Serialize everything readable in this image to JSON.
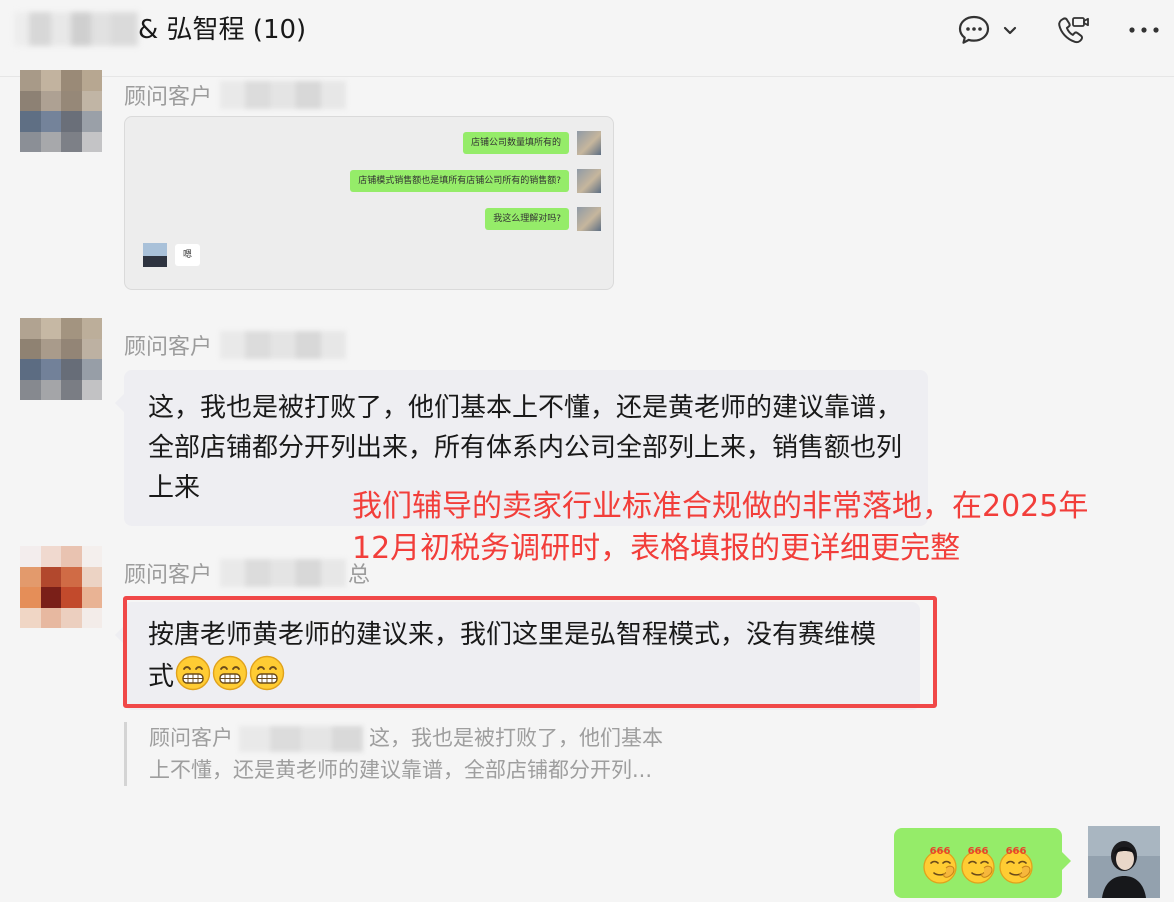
{
  "header": {
    "title": "& 弘智程 (10)",
    "icons": [
      "chat-bubble-icon",
      "chevron-down-icon",
      "video-call-icon",
      "more-icon"
    ]
  },
  "messages": [
    {
      "sender": "顾问客户",
      "sender_suffix": "",
      "type": "image",
      "screenshot": {
        "outgoing": [
          "店铺公司数量填所有的",
          "店铺模式销售额也是填所有店铺公司所有的销售额?",
          "我这么理解对吗?"
        ],
        "incoming": [
          "嗯"
        ]
      }
    },
    {
      "sender": "顾问客户",
      "sender_suffix": "",
      "type": "text",
      "text": "这，我也是被打败了，他们基本上不懂，还是黄老师的建议靠谱，全部店铺都分开列出来，所有体系内公司全部列上来，销售额也列上来"
    },
    {
      "sender": "顾问客户",
      "sender_suffix": "总",
      "type": "text",
      "text": "按唐老师黄老师的建议来，我们这里是弘智程模式，没有赛维模式",
      "emojis": [
        "grin-emoji",
        "grin-emoji",
        "grin-emoji"
      ],
      "highlighted": true
    }
  ],
  "quote": {
    "sender": "顾问客户",
    "line1": "这，我也是被打败了，他们基本",
    "line2": "上不懂，还是黄老师的建议靠谱，全部店铺都分开列..."
  },
  "annotation": {
    "line1": "我们辅导的卖家行业标准合规做的非常落地，在2025年",
    "line2": "12月初税务调研时，表格填报的更详细更完整",
    "color": "#f23e3a"
  },
  "outgoing": {
    "emojis": [
      "666-emoji",
      "666-emoji",
      "666-emoji"
    ],
    "emoji_caption": "666"
  },
  "colors": {
    "outgoing_bubble": "#95ec69",
    "incoming_bubble": "#ffffff",
    "highlight_border": "#f04848"
  }
}
